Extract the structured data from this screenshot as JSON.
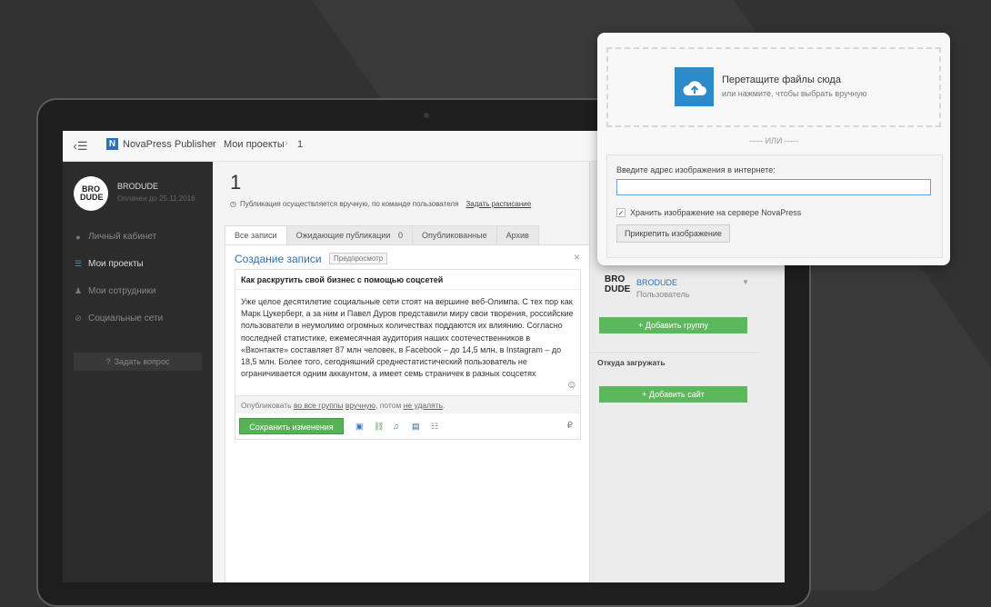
{
  "topbar": {
    "app_name": "NovaPress Publisher",
    "breadcrumb": [
      "Мои проекты",
      "1"
    ],
    "logo_letter": "N"
  },
  "sidebar": {
    "avatar_text": "BRO DUDE",
    "user_name": "BRODUDE",
    "paid_until": "Оплачен до 25.11.2016",
    "items": [
      {
        "label": "Личный кабинет",
        "icon": "user-icon"
      },
      {
        "label": "Мои проекты",
        "icon": "list-icon"
      },
      {
        "label": "Мои сотрудники",
        "icon": "team-icon"
      },
      {
        "label": "Социальные сети",
        "icon": "share-icon"
      }
    ],
    "ask_button": "Задать вопрос"
  },
  "main": {
    "title": "1",
    "schedule_text": "Публикация осуществляется вручную, по команде пользователя",
    "schedule_link": "Задать расписание",
    "tabs": [
      {
        "label": "Все записи"
      },
      {
        "label": "Ожидающие публикации",
        "count": "0"
      },
      {
        "label": "Опубликованные"
      },
      {
        "label": "Архив"
      }
    ],
    "card": {
      "heading": "Создание записи",
      "preview": "Предпросмотр",
      "close": "×",
      "post_title": "Как раскрутить свой бизнес с помощью соцсетей",
      "post_body": "Уже целое десятилетие социальные сети стоят на вершине веб-Олимпа. С тех пор как Марк Цукерберг, а за ним и Павел Дуров представили миру свои творения, российские пользователи в неумолимо огромных количествах поддаются их влиянию. Согласно последней статистике, ежемесячная аудитория наших соотечественников в «Вконтакте» составляет 87 млн человек, в Facebook – до 14,5 млн, в Instagram – до 18,5 млн. Более того, сегодняшний среднестатистический пользователь не ограничивается одним аккаунтом, а имеет семь страничек в разных соцсетях",
      "publish_row": {
        "prefix": "Опубликовать",
        "where": "во все группы",
        "how": "вручную",
        "middle": ", потом",
        "after": "не удалять",
        "suffix": "."
      },
      "save_button": "Сохранить изменения",
      "currency": "₽"
    }
  },
  "right_panel": {
    "brand_logo": "BRO DUDE",
    "brand_name": "BRODUDE",
    "brand_role": "Пользователь",
    "add_group": "+ Добавить группу",
    "source_label": "Откуда загружать",
    "add_site": "+ Добавить сайт"
  },
  "popup": {
    "drop_title": "Перетащите файлы сюда",
    "drop_sub": "или нажмите, чтобы выбрать вручную",
    "or": "----- ИЛИ -----",
    "url_label": "Введите адрес изображения в интернете:",
    "url_value": "",
    "keep_label": "Хранить изображение на сервере NovaPress",
    "keep_checked": "✓",
    "attach_button": "Прикрепить изображение"
  }
}
